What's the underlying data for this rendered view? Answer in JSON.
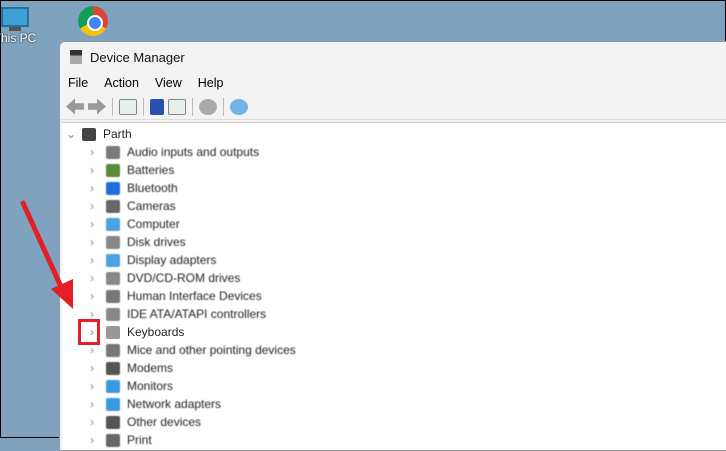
{
  "desktop": {
    "this_pc_label": "This PC"
  },
  "window": {
    "title": "Device Manager",
    "menu": [
      "File",
      "Action",
      "View",
      "Help"
    ],
    "root": "Parth",
    "items": [
      "Audio inputs and outputs",
      "Batteries",
      "Bluetooth",
      "Cameras",
      "Computer",
      "Disk drives",
      "Display adapters",
      "DVD/CD-ROM drives",
      "Human Interface Devices",
      "IDE ATA/ATAPI controllers",
      "Keyboards",
      "Mice and other pointing devices",
      "Modems",
      "Monitors",
      "Network adapters",
      "Other devices",
      "Print"
    ]
  },
  "icon_colors": [
    "#7a7a7a",
    "#5a8a3a",
    "#1e6fd9",
    "#666",
    "#4aa3df",
    "#888",
    "#4aa3df",
    "#888",
    "#777",
    "#888",
    "#999",
    "#777",
    "#555",
    "#3a9ae0",
    "#3a9ae0",
    "#555",
    "#666"
  ],
  "annotation_color": "#e41e26"
}
